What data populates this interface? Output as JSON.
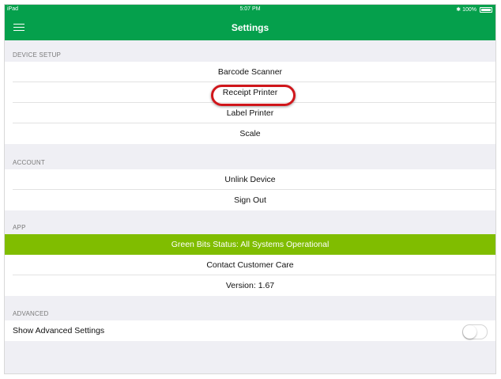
{
  "status_bar": {
    "device": "iPad",
    "time": "5:07 PM",
    "bluetooth": "✱",
    "battery": "100%"
  },
  "nav": {
    "title": "Settings",
    "menu_icon": "hamburger-menu-icon"
  },
  "sections": {
    "device_setup": {
      "header": "DEVICE SETUP",
      "items": [
        "Barcode Scanner",
        "Receipt Printer",
        "Label Printer",
        "Scale"
      ]
    },
    "account": {
      "header": "ACCOUNT",
      "items": [
        "Unlink Device",
        "Sign Out"
      ]
    },
    "app": {
      "header": "APP",
      "status": "Green Bits Status: All Systems Operational",
      "items": [
        "Contact Customer Care",
        "Version: 1.67"
      ]
    },
    "advanced": {
      "header": "ADVANCED",
      "show_advanced_label": "Show Advanced Settings",
      "show_advanced_on": false
    }
  },
  "colors": {
    "brand_green": "#05a04c",
    "status_green": "#80bd00",
    "highlight": "#d0161b"
  }
}
